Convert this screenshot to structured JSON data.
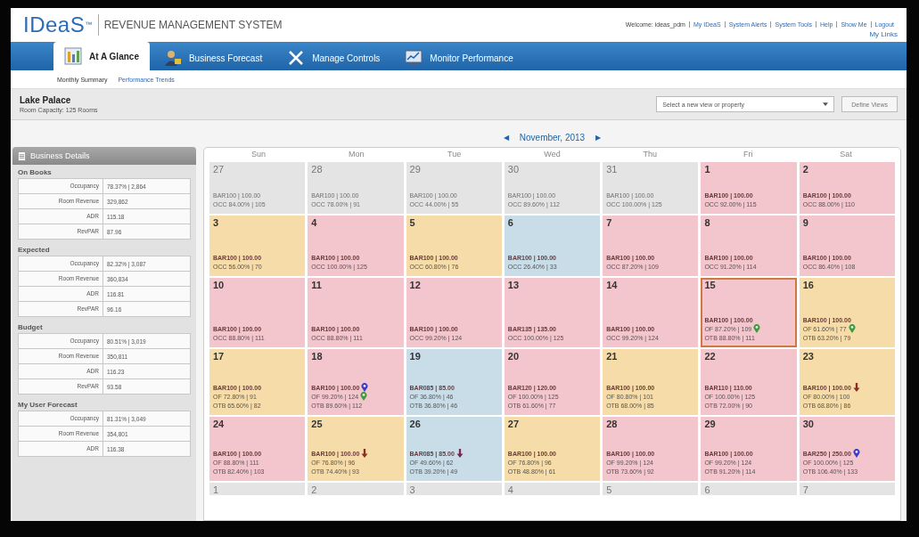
{
  "header": {
    "logo": "IDeaS",
    "logo_mark": "™",
    "product": "REVENUE MANAGEMENT SYSTEM",
    "welcome": "Welcome: ideas_pdm",
    "links": [
      "My IDeaS",
      "System Alerts",
      "System Tools",
      "Help",
      "Show Me",
      "Logout"
    ],
    "my_links": "My Links"
  },
  "tabs": [
    {
      "label": "At A Glance",
      "kind": "chart",
      "selected": true
    },
    {
      "label": "Business Forecast",
      "kind": "person",
      "selected": false
    },
    {
      "label": "Manage Controls",
      "kind": "tools",
      "selected": false
    },
    {
      "label": "Monitor Performance",
      "kind": "monitor",
      "selected": false
    }
  ],
  "subtabs": [
    {
      "label": "Monthly Summary",
      "selected": true
    },
    {
      "label": "Performance Trends",
      "selected": false
    }
  ],
  "property": {
    "name": "Lake Palace",
    "capacity": "Room Capacity: 125 Rooms",
    "view_select": {
      "placeholder": "Select a new view or property"
    },
    "define_button": "Define Views"
  },
  "sidebar": {
    "title": "Business Details",
    "sections": [
      {
        "title": "On Books",
        "rows": [
          {
            "label": "Occupancy",
            "value": "78.37% | 2,864"
          },
          {
            "label": "Room Revenue",
            "value": "329,862"
          },
          {
            "label": "ADR",
            "value": "115.18"
          },
          {
            "label": "RevPAR",
            "value": "87.96"
          }
        ]
      },
      {
        "title": "Expected",
        "rows": [
          {
            "label": "Occupancy",
            "value": "82.32% | 3,087"
          },
          {
            "label": "Room Revenue",
            "value": "360,834"
          },
          {
            "label": "ADR",
            "value": "116.81"
          },
          {
            "label": "RevPAR",
            "value": "96.16"
          }
        ]
      },
      {
        "title": "Budget",
        "rows": [
          {
            "label": "Occupancy",
            "value": "80.51% | 3,019"
          },
          {
            "label": "Room Revenue",
            "value": "350,811"
          },
          {
            "label": "ADR",
            "value": "116.23"
          },
          {
            "label": "RevPAR",
            "value": "93.58"
          }
        ]
      },
      {
        "title": "My User Forecast",
        "rows": [
          {
            "label": "Occupancy",
            "value": "81.31% | 3,049"
          },
          {
            "label": "Room Revenue",
            "value": "354,801"
          },
          {
            "label": "ADR",
            "value": "116.38"
          }
        ]
      }
    ]
  },
  "calendar": {
    "month": "November, 2013",
    "prev": "◀",
    "next": "▶",
    "weekdays": [
      "Sun",
      "Mon",
      "Tue",
      "Wed",
      "Thu",
      "Fri",
      "Sat"
    ],
    "weeks": [
      [
        {
          "day": "27",
          "in_month": false,
          "color": "#e4e4e4",
          "selected": false,
          "lines": [
            {
              "text": "BAR100 | 100.00"
            },
            {
              "text": "OCC 84.00% | 105"
            }
          ]
        },
        {
          "day": "28",
          "in_month": false,
          "color": "#e4e4e4",
          "selected": false,
          "lines": [
            {
              "text": "BAR100 | 100.00"
            },
            {
              "text": "OCC 78.00% | 91"
            }
          ]
        },
        {
          "day": "29",
          "in_month": false,
          "color": "#e4e4e4",
          "selected": false,
          "lines": [
            {
              "text": "BAR100 | 100.00"
            },
            {
              "text": "OCC 44.00% | 55"
            }
          ]
        },
        {
          "day": "30",
          "in_month": false,
          "color": "#e4e4e4",
          "selected": false,
          "lines": [
            {
              "text": "BAR100 | 100.00"
            },
            {
              "text": "OCC 89.60% | 112"
            }
          ]
        },
        {
          "day": "31",
          "in_month": false,
          "color": "#e4e4e4",
          "selected": false,
          "lines": [
            {
              "text": "BAR100 | 100.00"
            },
            {
              "text": "OCC 100.00% | 125"
            }
          ]
        },
        {
          "day": "1",
          "in_month": true,
          "color": "#f2c6cc",
          "selected": false,
          "lines": [
            {
              "text": "BAR100 | 100.00"
            },
            {
              "text": "OCC 92.00% | 115"
            }
          ]
        },
        {
          "day": "2",
          "in_month": true,
          "color": "#f2c6cc",
          "selected": false,
          "lines": [
            {
              "text": "BAR100 | 100.00"
            },
            {
              "text": "OCC 88.00% | 110"
            }
          ]
        }
      ],
      [
        {
          "day": "3",
          "in_month": true,
          "color": "#f5dca8",
          "selected": false,
          "lines": [
            {
              "text": "BAR100 | 100.00"
            },
            {
              "text": "OCC 56.00% | 70"
            }
          ]
        },
        {
          "day": "4",
          "in_month": true,
          "color": "#f2c6cc",
          "selected": false,
          "lines": [
            {
              "text": "BAR100 | 100.00"
            },
            {
              "text": "OCC 100.00% | 125"
            }
          ]
        },
        {
          "day": "5",
          "in_month": true,
          "color": "#f5dca8",
          "selected": false,
          "lines": [
            {
              "text": "BAR100 | 100.00"
            },
            {
              "text": "OCC 60.80% | 76"
            }
          ]
        },
        {
          "day": "6",
          "in_month": true,
          "color": "#c9dde8",
          "selected": false,
          "lines": [
            {
              "text": "BAR100 | 100.00"
            },
            {
              "text": "OCC 26.40% | 33"
            }
          ]
        },
        {
          "day": "7",
          "in_month": true,
          "color": "#f2c6cc",
          "selected": false,
          "lines": [
            {
              "text": "BAR100 | 100.00"
            },
            {
              "text": "OCC 87.20% | 109"
            }
          ]
        },
        {
          "day": "8",
          "in_month": true,
          "color": "#f2c6cc",
          "selected": false,
          "lines": [
            {
              "text": "BAR100 | 100.00"
            },
            {
              "text": "OCC 91.20% | 114"
            }
          ]
        },
        {
          "day": "9",
          "in_month": true,
          "color": "#f2c6cc",
          "selected": false,
          "lines": [
            {
              "text": "BAR100 | 100.00"
            },
            {
              "text": "OCC 86.40% | 108"
            }
          ]
        }
      ],
      [
        {
          "day": "10",
          "in_month": true,
          "color": "#f2c6cc",
          "selected": false,
          "lines": [
            {
              "text": "BAR100 | 100.00"
            },
            {
              "text": "OCC 88.80% | 111"
            }
          ]
        },
        {
          "day": "11",
          "in_month": true,
          "color": "#f2c6cc",
          "selected": false,
          "lines": [
            {
              "text": "BAR100 | 100.00"
            },
            {
              "text": "OCC 88.80% | 111"
            }
          ]
        },
        {
          "day": "12",
          "in_month": true,
          "color": "#f2c6cc",
          "selected": false,
          "lines": [
            {
              "text": "BAR100 | 100.00"
            },
            {
              "text": "OCC 99.20% | 124"
            }
          ]
        },
        {
          "day": "13",
          "in_month": true,
          "color": "#f2c6cc",
          "selected": false,
          "lines": [
            {
              "text": "BAR135 | 135.00"
            },
            {
              "text": "OCC 100.00% | 125"
            }
          ]
        },
        {
          "day": "14",
          "in_month": true,
          "color": "#f2c6cc",
          "selected": false,
          "lines": [
            {
              "text": "BAR100 | 100.00"
            },
            {
              "text": "OCC 99.20% | 124"
            }
          ]
        },
        {
          "day": "15",
          "in_month": true,
          "color": "#f2c6cc",
          "selected": true,
          "lines": [
            {
              "text": "BAR100 | 100.00"
            },
            {
              "text": "OF 87.20% | 109",
              "marker": {
                "kind": "pin",
                "color": "#3c9a3c"
              }
            },
            {
              "text": "OTB 88.80% | 111"
            }
          ]
        },
        {
          "day": "16",
          "in_month": true,
          "color": "#f5dca8",
          "selected": false,
          "lines": [
            {
              "text": "BAR100 | 100.00"
            },
            {
              "text": "OF 61.60% | 77",
              "marker": {
                "kind": "pin",
                "color": "#3c9a3c"
              }
            },
            {
              "text": "OTB 63.20% | 79"
            }
          ]
        }
      ],
      [
        {
          "day": "17",
          "in_month": true,
          "color": "#f5dca8",
          "selected": false,
          "lines": [
            {
              "text": "BAR100 | 100.00"
            },
            {
              "text": "OF 72.80% | 91"
            },
            {
              "text": "OTB 65.60% | 82"
            }
          ]
        },
        {
          "day": "18",
          "in_month": true,
          "color": "#f2c6cc",
          "selected": false,
          "lines": [
            {
              "text": "BAR100 | 100.00",
              "marker": {
                "kind": "pin",
                "color": "#3b3bc8"
              }
            },
            {
              "text": "OF 99.20% | 124",
              "marker": {
                "kind": "pin",
                "color": "#3c9a3c"
              }
            },
            {
              "text": "OTB 89.60% | 112"
            }
          ]
        },
        {
          "day": "19",
          "in_month": true,
          "color": "#c9dde8",
          "selected": false,
          "lines": [
            {
              "text": "BAR085 | 85.00"
            },
            {
              "text": "OF 36.80% | 46"
            },
            {
              "text": "OTB 36.80% | 46"
            }
          ]
        },
        {
          "day": "20",
          "in_month": true,
          "color": "#f2c6cc",
          "selected": false,
          "lines": [
            {
              "text": "BAR120 | 120.00"
            },
            {
              "text": "OF 100.00% | 125"
            },
            {
              "text": "OTB 61.60% | 77"
            }
          ]
        },
        {
          "day": "21",
          "in_month": true,
          "color": "#f5dca8",
          "selected": false,
          "lines": [
            {
              "text": "BAR100 | 100.00"
            },
            {
              "text": "OF 80.80% | 101"
            },
            {
              "text": "OTB 68.00% | 85"
            }
          ]
        },
        {
          "day": "22",
          "in_month": true,
          "color": "#f2c6cc",
          "selected": false,
          "lines": [
            {
              "text": "BAR110 | 110.00"
            },
            {
              "text": "OF 100.00% | 125"
            },
            {
              "text": "OTB 72.00% | 90"
            }
          ]
        },
        {
          "day": "23",
          "in_month": true,
          "color": "#f5dca8",
          "selected": false,
          "lines": [
            {
              "text": "BAR100 | 100.00",
              "marker": {
                "kind": "down-arrow",
                "color": "#8a3020"
              }
            },
            {
              "text": "OF 80.00% | 100"
            },
            {
              "text": "OTB 68.80% | 86"
            }
          ]
        }
      ],
      [
        {
          "day": "24",
          "in_month": true,
          "color": "#f2c6cc",
          "selected": false,
          "lines": [
            {
              "text": "BAR100 | 100.00"
            },
            {
              "text": "OF 88.80% | 111"
            },
            {
              "text": "OTB 82.40% | 103"
            }
          ]
        },
        {
          "day": "25",
          "in_month": true,
          "color": "#f5dca8",
          "selected": false,
          "lines": [
            {
              "text": "BAR100 | 100.00",
              "marker": {
                "kind": "down-arrow",
                "color": "#8a3020"
              }
            },
            {
              "text": "OF 76.80% | 96"
            },
            {
              "text": "OTB 74.40% | 93"
            }
          ]
        },
        {
          "day": "26",
          "in_month": true,
          "color": "#c9dde8",
          "selected": false,
          "lines": [
            {
              "text": "BAR085 | 85.00",
              "marker": {
                "kind": "down-arrow",
                "color": "#7a2850"
              }
            },
            {
              "text": "OF 49.60% | 62"
            },
            {
              "text": "OTB 39.20% | 49"
            }
          ]
        },
        {
          "day": "27",
          "in_month": true,
          "color": "#f5dca8",
          "selected": false,
          "lines": [
            {
              "text": "BAR100 | 100.00"
            },
            {
              "text": "OF 76.80% | 96"
            },
            {
              "text": "OTB 48.80% | 61"
            }
          ]
        },
        {
          "day": "28",
          "in_month": true,
          "color": "#f2c6cc",
          "selected": false,
          "lines": [
            {
              "text": "BAR100 | 100.00"
            },
            {
              "text": "OF 99.20% | 124"
            },
            {
              "text": "OTB 73.60% | 92"
            }
          ]
        },
        {
          "day": "29",
          "in_month": true,
          "color": "#f2c6cc",
          "selected": false,
          "lines": [
            {
              "text": "BAR100 | 100.00"
            },
            {
              "text": "OF 99.20% | 124"
            },
            {
              "text": "OTB 91.20% | 114"
            }
          ]
        },
        {
          "day": "30",
          "in_month": true,
          "color": "#f2c6cc",
          "selected": false,
          "lines": [
            {
              "text": "BAR250 | 250.00",
              "marker": {
                "kind": "pin",
                "color": "#3b3bc8"
              }
            },
            {
              "text": "OF 100.00% | 125"
            },
            {
              "text": "OTB 106.40% | 133"
            }
          ]
        }
      ],
      [
        {
          "day": "1",
          "in_month": false,
          "color": "#e4e4e4",
          "selected": false
        },
        {
          "day": "2",
          "in_month": false,
          "color": "#e4e4e4",
          "selected": false
        },
        {
          "day": "3",
          "in_month": false,
          "color": "#e4e4e4",
          "selected": false
        },
        {
          "day": "4",
          "in_month": false,
          "color": "#e4e4e4",
          "selected": false
        },
        {
          "day": "5",
          "in_month": false,
          "color": "#e4e4e4",
          "selected": false
        },
        {
          "day": "6",
          "in_month": false,
          "color": "#e4e4e4",
          "selected": false
        },
        {
          "day": "7",
          "in_month": false,
          "color": "#e4e4e4",
          "selected": false
        }
      ]
    ]
  }
}
